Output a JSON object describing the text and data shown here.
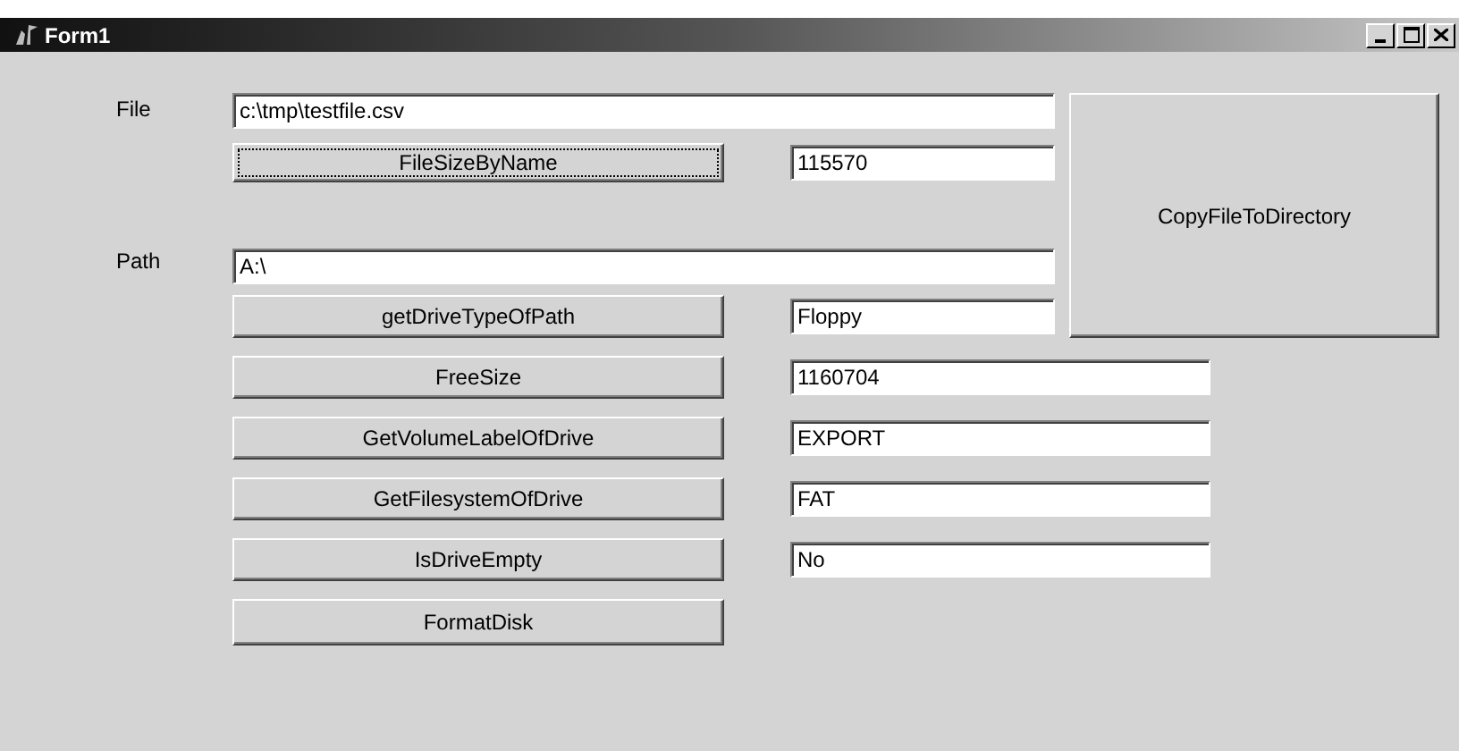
{
  "window": {
    "title": "Form1"
  },
  "file": {
    "label": "File",
    "value": "c:\\tmp\\testfile.csv"
  },
  "path": {
    "label": "Path",
    "value": "A:\\"
  },
  "copy_button": {
    "label": "CopyFileToDirectory"
  },
  "actions": [
    {
      "label": "FileSizeByName",
      "result": "115570",
      "focused": true
    },
    {
      "label": "getDriveTypeOfPath",
      "result": "Floppy",
      "focused": false
    },
    {
      "label": "FreeSize",
      "result": "1160704",
      "focused": false
    },
    {
      "label": "GetVolumeLabelOfDrive",
      "result": "EXPORT",
      "focused": false
    },
    {
      "label": "GetFilesystemOfDrive",
      "result": "FAT",
      "focused": false
    },
    {
      "label": "IsDriveEmpty",
      "result": "No",
      "focused": false
    },
    {
      "label": "FormatDisk",
      "focused": false
    }
  ]
}
